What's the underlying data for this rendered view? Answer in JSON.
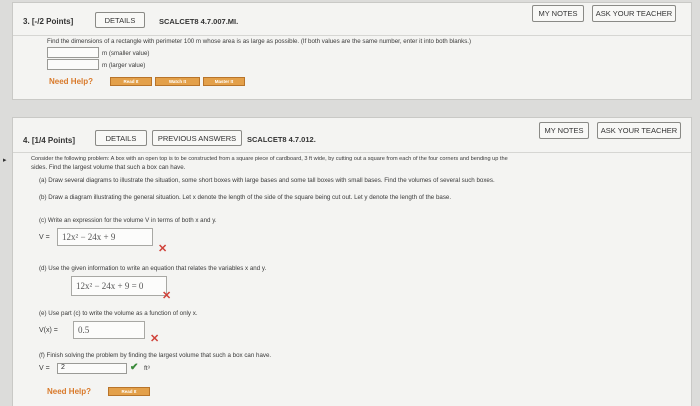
{
  "q3": {
    "number": "3. [-/2 Points]",
    "details": "DETAILS",
    "code": "SCALCET8 4.7.007.MI.",
    "my_notes": "MY NOTES",
    "ask": "ASK YOUR TEACHER",
    "prompt": "Find the dimensions of a rectangle with perimeter 100 m whose area is as large as possible. (If both values are the same number, enter it into both blanks.)",
    "blank1_label": "m (smaller value)",
    "blank2_label": "m (larger value)",
    "need_help": "Need Help?",
    "help_buttons": [
      "Read It",
      "Watch It",
      "Master It"
    ]
  },
  "q4": {
    "number": "4. [1/4 Points]",
    "details": "DETAILS",
    "previous": "PREVIOUS ANSWERS",
    "code": "SCALCET8 4.7.012.",
    "my_notes": "MY NOTES",
    "ask": "ASK YOUR TEACHER",
    "prompt_line1": "Consider the following problem: A box with an open top is to be constructed from a square piece of cardboard, 3 ft wide, by cutting out a square from each of the four corners and bending up the",
    "prompt_line2": "sides. Find the largest volume that such a box can have.",
    "part_a": "(a) Draw several diagrams to illustrate the situation, some short boxes with large bases and some tall boxes with small bases. Find the volumes of several such boxes.",
    "part_b": "(b) Draw a diagram illustrating the general situation. Let x denote the length of the side of the square being cut out. Let y denote the length of the base.",
    "part_c": "(c) Write an expression for the volume V in terms of both x and y.",
    "part_c_prefix": "V =",
    "part_c_answer": "12x² − 24x + 9",
    "part_d": "(d) Use the given information to write an equation that relates the variables x and y.",
    "part_d_answer": "12x² − 24x + 9 = 0",
    "part_e": "(e) Use part (c) to write the volume as a function of only x.",
    "part_e_prefix": "V(x) =",
    "part_e_answer": "0.5",
    "part_f": "(f) Finish solving the problem by finding the largest volume that such a box can have.",
    "part_f_prefix": "V =",
    "part_f_answer": "2",
    "part_f_unit": "ft³",
    "need_help": "Need Help?",
    "help_buttons": [
      "Read It"
    ]
  },
  "icons": {
    "wrong": "x-mark-icon",
    "correct": "check-mark-icon"
  },
  "colors": {
    "wrong": "#d0423a",
    "correct": "#3a8a3a",
    "need_help": "#d97a2b",
    "help_button": "#e3a04a"
  }
}
